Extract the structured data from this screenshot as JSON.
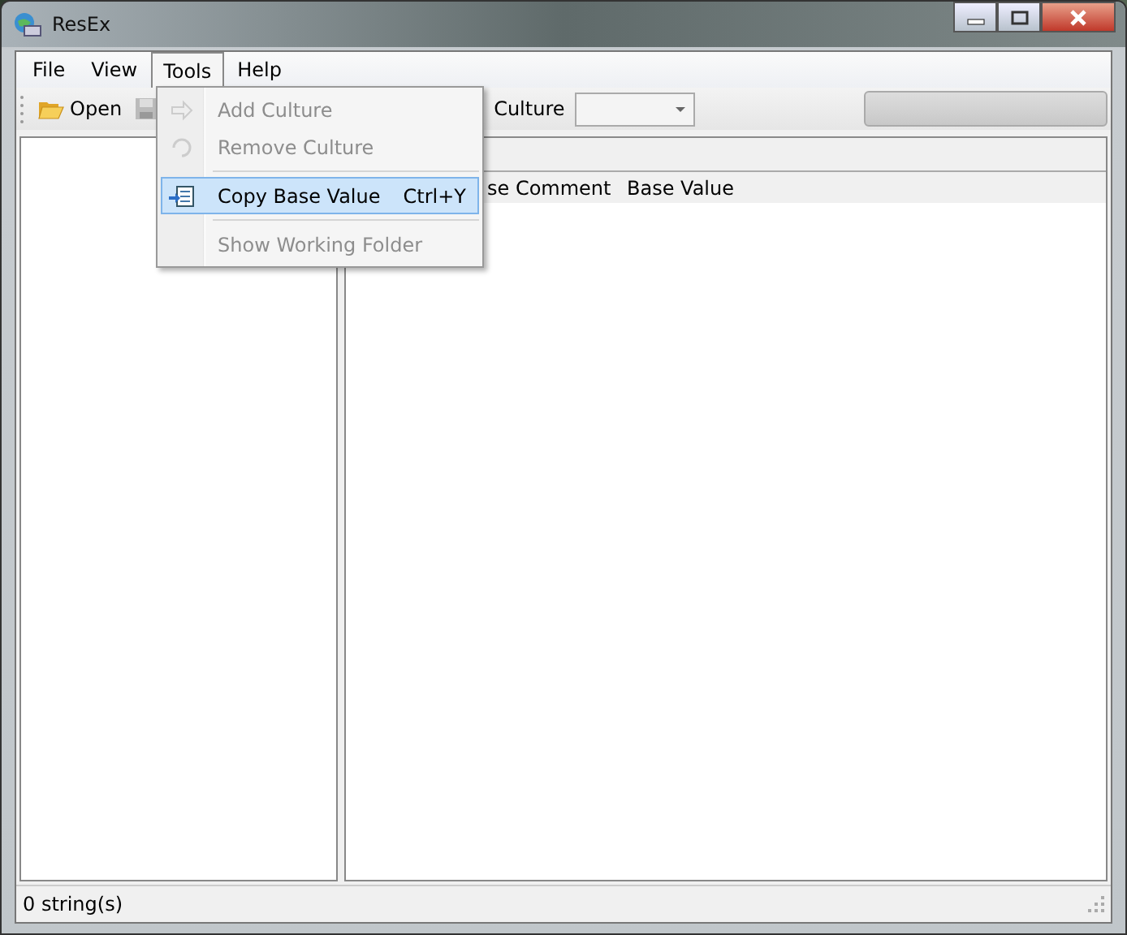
{
  "window": {
    "title": "ResEx"
  },
  "menu_bar": [
    {
      "label": "File",
      "selected": false
    },
    {
      "label": "View",
      "selected": false
    },
    {
      "label": "Tools",
      "selected": true
    },
    {
      "label": "Help",
      "selected": false
    }
  ],
  "toolbar": {
    "open": "Open",
    "culture_label": "Culture",
    "progress": {
      "level": 0
    }
  },
  "tools_menu": [
    {
      "kind": "item",
      "label": "Add Culture",
      "disabled": true,
      "selected": false
    },
    {
      "kind": "item",
      "label": "Remove Culture",
      "disabled": true,
      "selected": false
    },
    {
      "kind": "separator"
    },
    {
      "kind": "item",
      "label": "Copy Base Value",
      "shortcut": "Ctrl+Y",
      "disabled": false,
      "selected": true
    },
    {
      "kind": "separator"
    },
    {
      "kind": "item",
      "label": "Show Working Folder",
      "disabled": true,
      "selected": false
    }
  ],
  "table": {
    "columns": [
      "se Comment",
      "Base Value"
    ]
  },
  "status_bar": "0 string(s)"
}
